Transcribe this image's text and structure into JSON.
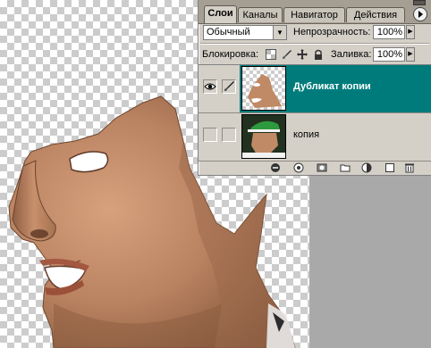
{
  "layers_panel": {
    "tabs": [
      {
        "label": "Слои",
        "active": true
      },
      {
        "label": "Каналы",
        "active": false
      },
      {
        "label": "Навигатор",
        "active": false
      },
      {
        "label": "Действия",
        "active": false
      }
    ],
    "blend_mode": "Обычный",
    "opacity_label": "Непрозрачность:",
    "opacity_value": "100%",
    "lock_label": "Блокировка:",
    "fill_label": "Заливка:",
    "fill_value": "100%",
    "layers": [
      {
        "name": "Дубликат копии",
        "selected": true,
        "visible": true
      },
      {
        "name": "копия",
        "selected": false,
        "visible": false
      }
    ]
  },
  "colors": {
    "selected_layer": "#007b7b",
    "panel_bg": "#d4d0c8",
    "workspace": "#a9a9a9"
  },
  "icons": [
    "eye-icon",
    "brush-icon",
    "lock-transparency-icon",
    "lock-brush-icon",
    "lock-move-icon",
    "lock-all-icon",
    "link-layers-icon",
    "layer-style-icon",
    "layer-mask-icon",
    "new-group-icon",
    "adjustment-layer-icon",
    "new-layer-icon",
    "trash-icon",
    "menu-arrow-icon"
  ]
}
